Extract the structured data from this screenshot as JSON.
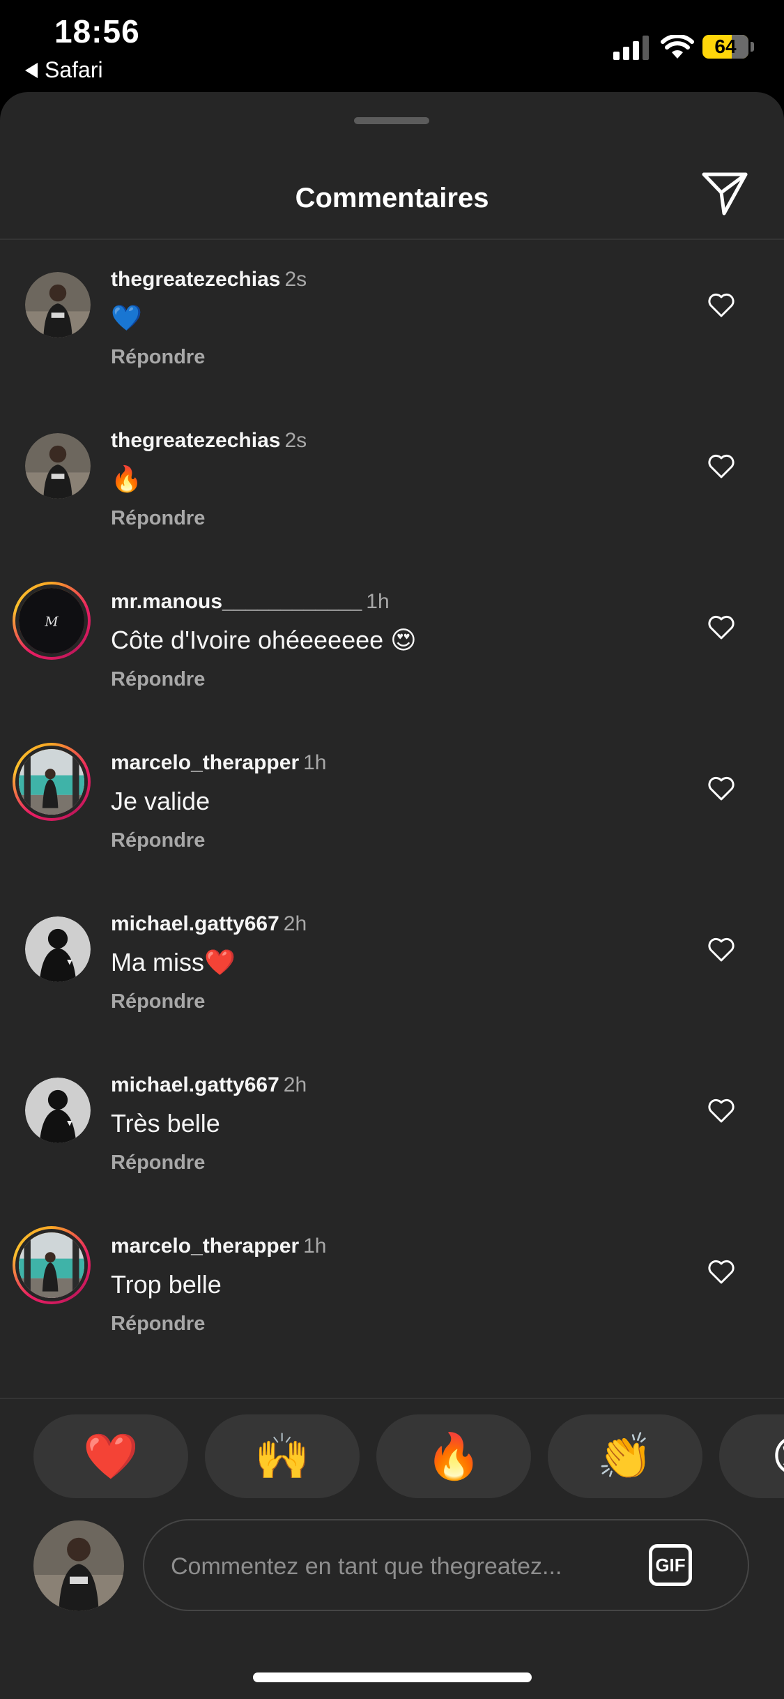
{
  "status_bar": {
    "time": "18:56",
    "back_app": "Safari",
    "battery_level": "64",
    "battery_fraction": 0.64,
    "icons": [
      "signal-icon",
      "wifi-icon",
      "battery-icon"
    ]
  },
  "header": {
    "title": "Commentaires",
    "share_icon": "send-icon"
  },
  "comments": [
    {
      "username": "thegreatezechias",
      "time": "2s",
      "text": "💙",
      "reply": "Répondre",
      "like_icon": "heart-outline-icon"
    },
    {
      "username": "thegreatezechias",
      "time": "2s",
      "text": "🔥",
      "reply": "Répondre",
      "like_icon": "heart-outline-icon"
    },
    {
      "username": "mr.manous____________",
      "time": "1h",
      "text": "Côte d'Ivoire ohéeeeeee 😍",
      "reply": "Répondre",
      "like_icon": "heart-outline-icon"
    },
    {
      "username": "marcelo_therapper",
      "time": "1h",
      "text": "Je valide",
      "reply": "Répondre",
      "like_icon": "heart-outline-icon"
    },
    {
      "username": "michael.gatty667",
      "time": "2h",
      "text": "Ma miss❤️",
      "reply": "Répondre",
      "like_icon": "heart-outline-icon"
    },
    {
      "username": "michael.gatty667",
      "time": "2h",
      "text": "Très belle",
      "reply": "Répondre",
      "like_icon": "heart-outline-icon"
    },
    {
      "username": "marcelo_therapper",
      "time": "1h",
      "text": "Trop belle",
      "reply": "Répondre",
      "like_icon": "heart-outline-icon"
    }
  ],
  "quick_reactions": [
    "❤️",
    "🙌",
    "🔥",
    "👏",
    "😢"
  ],
  "composer": {
    "placeholder": "Commentez en tant que thegreatez...",
    "value": "",
    "gif_label": "GIF"
  },
  "colors": {
    "sheet_background": "#262626",
    "secondary_text": "#a8a8a8",
    "story_ring": "#e91e63",
    "battery": "#ffd60a"
  }
}
